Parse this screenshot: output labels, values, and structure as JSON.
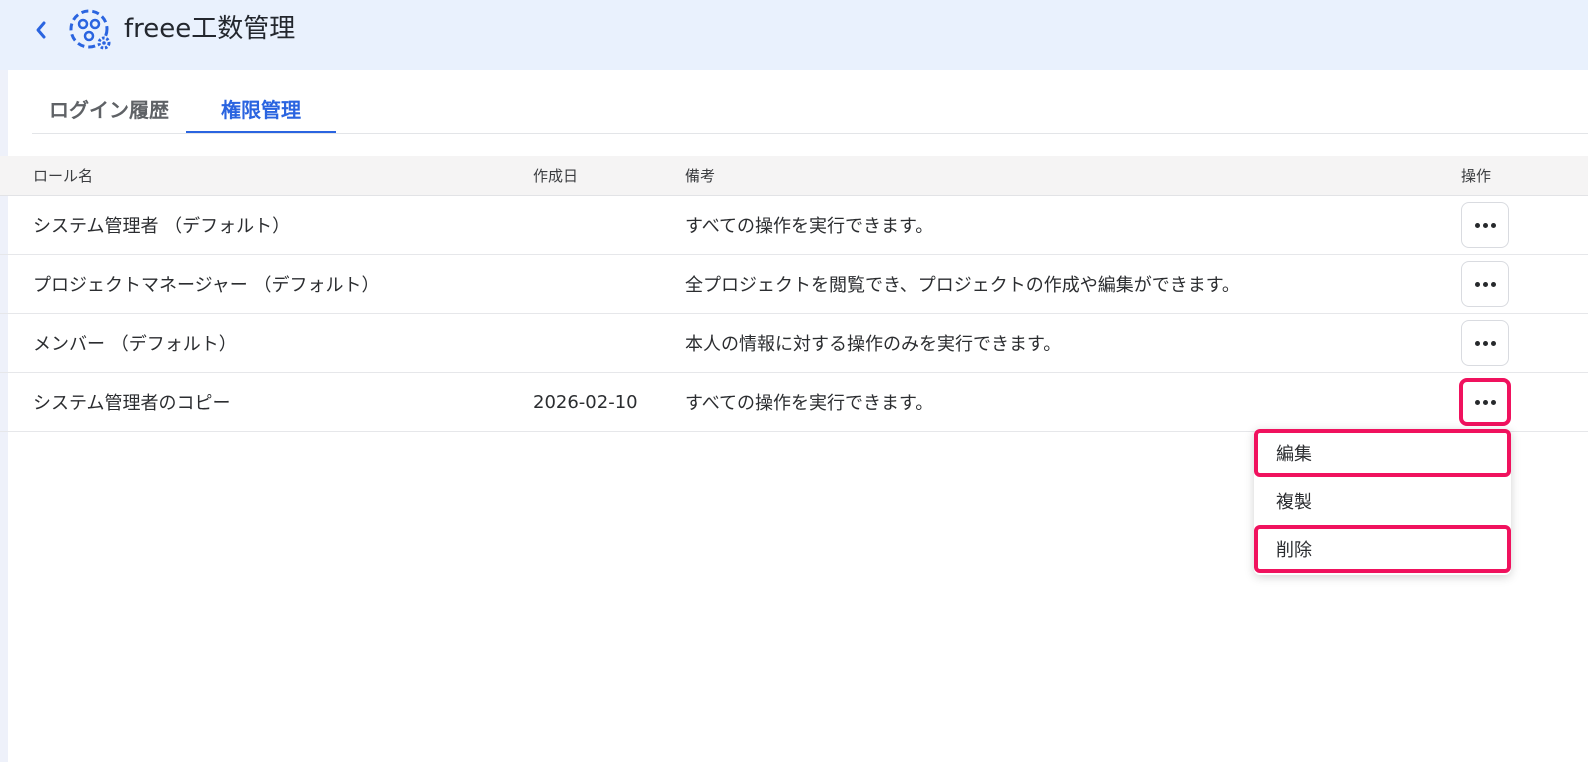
{
  "app": {
    "title": "freee工数管理",
    "back_icon": "chevron-left-icon",
    "logo_icon": "gear-people-icon",
    "accent_color": "#2a64e0",
    "highlight_color": "#f0125e"
  },
  "tabs": [
    {
      "label": "ログイン履歴",
      "active": false
    },
    {
      "label": "権限管理",
      "active": true
    }
  ],
  "table": {
    "headers": {
      "name": "ロール名",
      "date": "作成日",
      "note": "備考",
      "ops": "操作"
    },
    "rows": [
      {
        "name": "システム管理者 （デフォルト）",
        "date": "",
        "note": "すべての操作を実行できます。"
      },
      {
        "name": "プロジェクトマネージャー （デフォルト）",
        "date": "",
        "note": "全プロジェクトを閲覧でき、プロジェクトの作成や編集ができます。"
      },
      {
        "name": "メンバー （デフォルト）",
        "date": "",
        "note": "本人の情報に対する操作のみを実行できます。"
      },
      {
        "name": "システム管理者のコピー",
        "date": "2026-02-10",
        "note": "すべての操作を実行できます。"
      }
    ]
  },
  "menu": {
    "items": [
      {
        "label": "編集",
        "highlighted": true
      },
      {
        "label": "複製",
        "highlighted": false
      },
      {
        "label": "削除",
        "highlighted": true
      }
    ]
  }
}
